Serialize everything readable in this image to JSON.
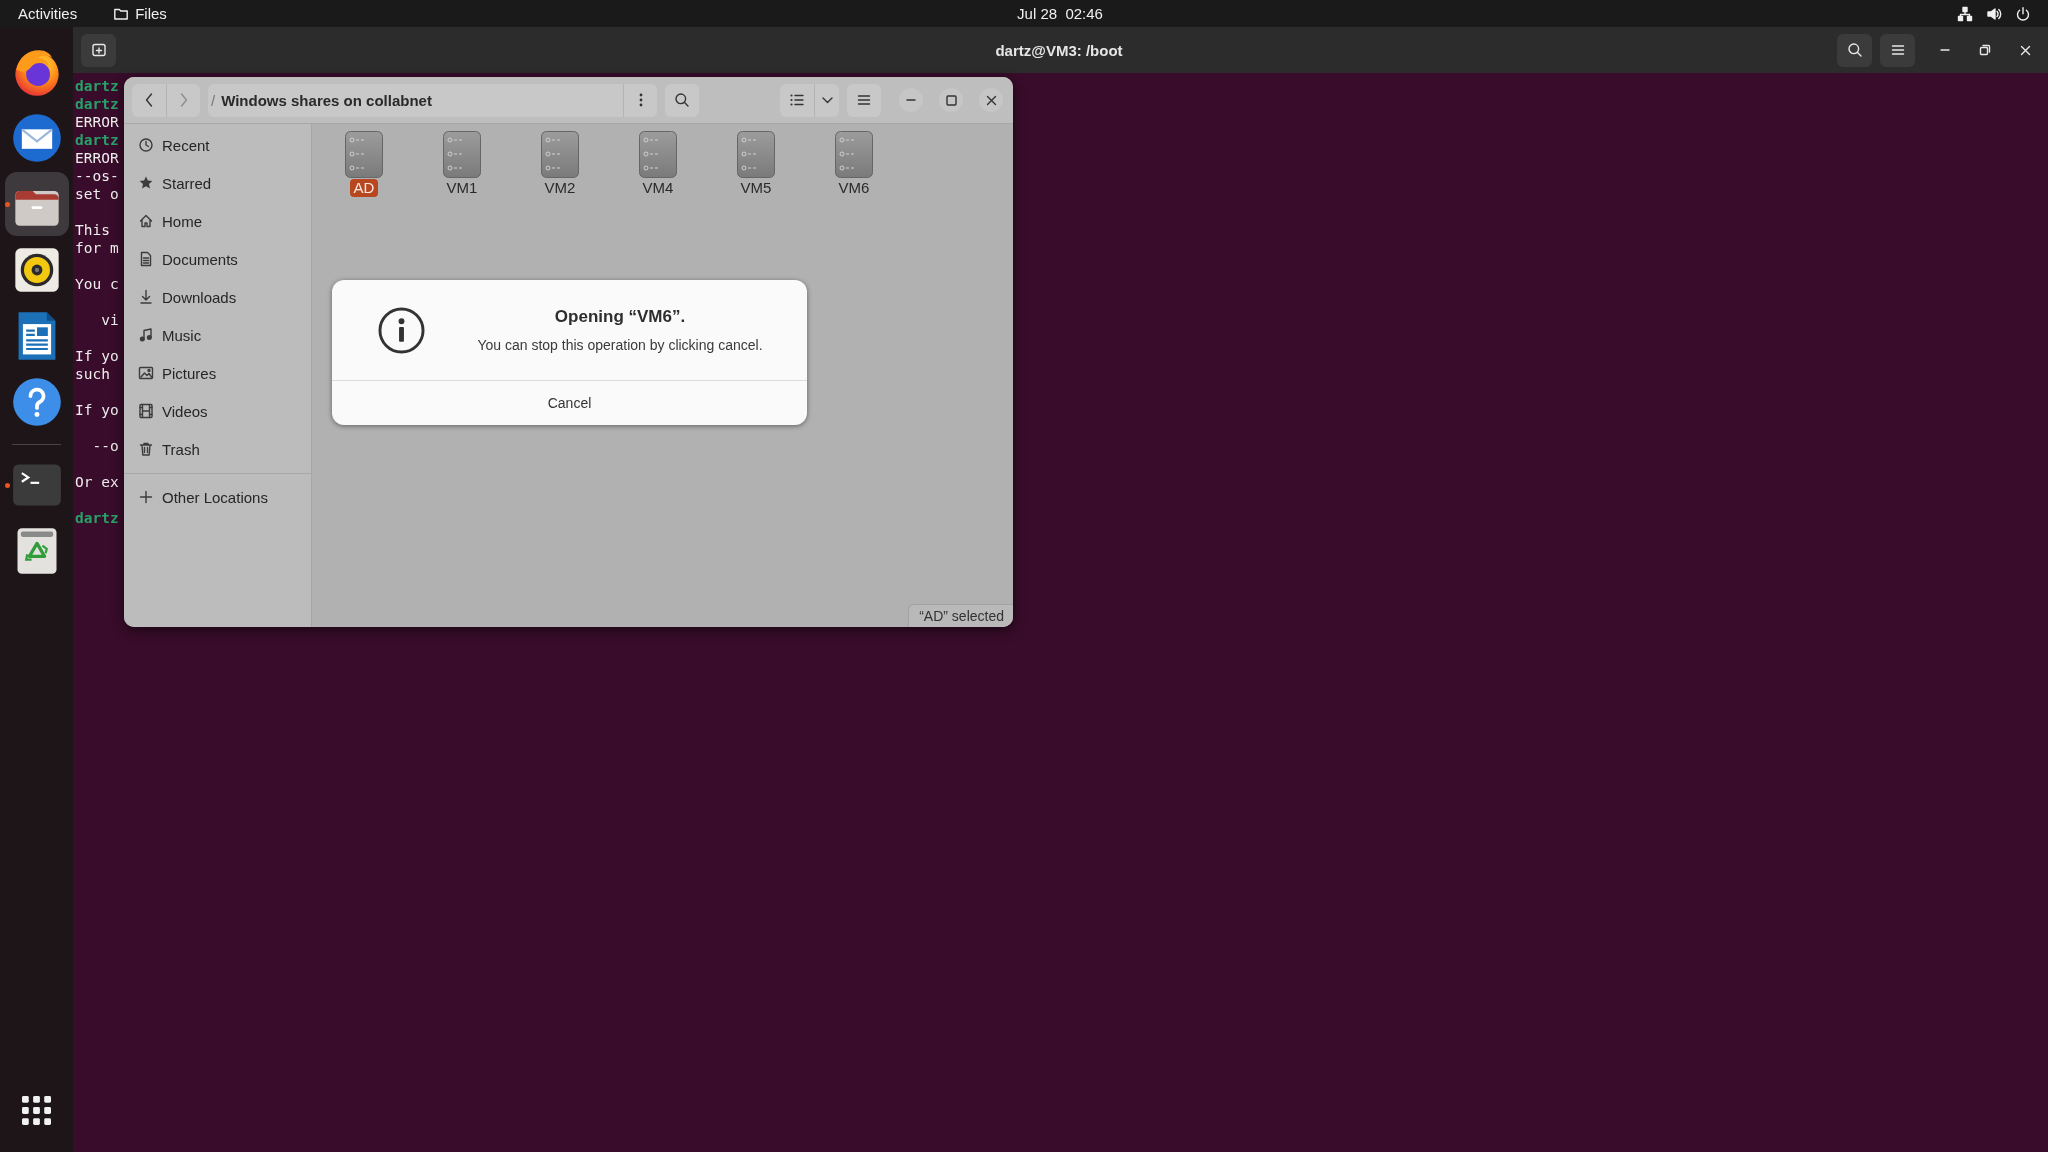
{
  "top_bar": {
    "activities": "Activities",
    "app_menu": "Files",
    "clock": "Jul 28  02:46"
  },
  "dock": {
    "favorites": [
      {
        "kind": "browser",
        "running": false,
        "selected": false
      },
      {
        "kind": "mail",
        "running": false,
        "selected": false
      },
      {
        "kind": "files",
        "running": true,
        "selected": true
      },
      {
        "kind": "music",
        "running": false,
        "selected": false
      },
      {
        "kind": "writer",
        "running": false,
        "selected": false
      },
      {
        "kind": "help",
        "running": false,
        "selected": false
      }
    ],
    "others": [
      {
        "kind": "terminal",
        "running": true,
        "selected": false
      },
      {
        "kind": "trash",
        "running": false,
        "selected": false
      }
    ]
  },
  "terminal": {
    "title": "dartz@VM3: /boot",
    "paragraphs": [
      [
        {
          "kind": "prompt",
          "text": "dartz"
        },
        {
          "kind": "prompt",
          "text": "dartz"
        },
        {
          "kind": "output",
          "text": "ERROR"
        },
        {
          "kind": "prompt",
          "text": "dartz"
        },
        {
          "kind": "output",
          "text": "ERROR"
        },
        {
          "kind": "output",
          "text": "--os-"
        },
        {
          "kind": "output",
          "text": "set o"
        }
      ],
      [
        {
          "kind": "output",
          "text": "This"
        },
        {
          "kind": "output",
          "text": "for m"
        }
      ],
      [
        {
          "kind": "output",
          "text": "You c"
        }
      ],
      [
        {
          "kind": "output",
          "text": "   vi"
        }
      ],
      [
        {
          "kind": "output",
          "text": "If yo"
        },
        {
          "kind": "output",
          "text": "such"
        }
      ],
      [
        {
          "kind": "output",
          "text": "If yo"
        }
      ],
      [
        {
          "kind": "output",
          "text": "  --o"
        }
      ],
      [
        {
          "kind": "output",
          "text": "Or ex"
        }
      ],
      [
        {
          "kind": "prompt",
          "text": "dartz"
        }
      ]
    ]
  },
  "files_window": {
    "nav": [
      {
        "kind": "back",
        "disabled": false
      },
      {
        "kind": "forward",
        "disabled": true
      }
    ],
    "path": {
      "separator": "/",
      "location": "Windows shares on collabnet"
    },
    "sidebar": {
      "places": [
        {
          "kind": "recent",
          "label": "Recent",
          "selected": false
        },
        {
          "kind": "starred",
          "label": "Starred",
          "selected": false
        },
        {
          "kind": "home",
          "label": "Home",
          "selected": false
        },
        {
          "kind": "documents",
          "label": "Documents",
          "selected": false
        },
        {
          "kind": "downloads",
          "label": "Downloads",
          "selected": false
        },
        {
          "kind": "music",
          "label": "Music",
          "selected": false
        },
        {
          "kind": "pictures",
          "label": "Pictures",
          "selected": false
        },
        {
          "kind": "videos",
          "label": "Videos",
          "selected": false
        },
        {
          "kind": "trash",
          "label": "Trash",
          "selected": false
        }
      ],
      "other_places": [
        {
          "kind": "other",
          "label": "Other Locations",
          "selected": false
        }
      ]
    },
    "items": [
      {
        "label": "AD",
        "selected": true
      },
      {
        "label": "VM1",
        "selected": false
      },
      {
        "label": "VM2",
        "selected": false
      },
      {
        "label": "VM4",
        "selected": false
      },
      {
        "label": "VM5",
        "selected": false
      },
      {
        "label": "VM6",
        "selected": false
      }
    ],
    "status": "“AD” selected",
    "dialog": {
      "title": "Opening “VM6”.",
      "message": "You can stop this operation by clicking cancel.",
      "button": "Cancel"
    }
  }
}
